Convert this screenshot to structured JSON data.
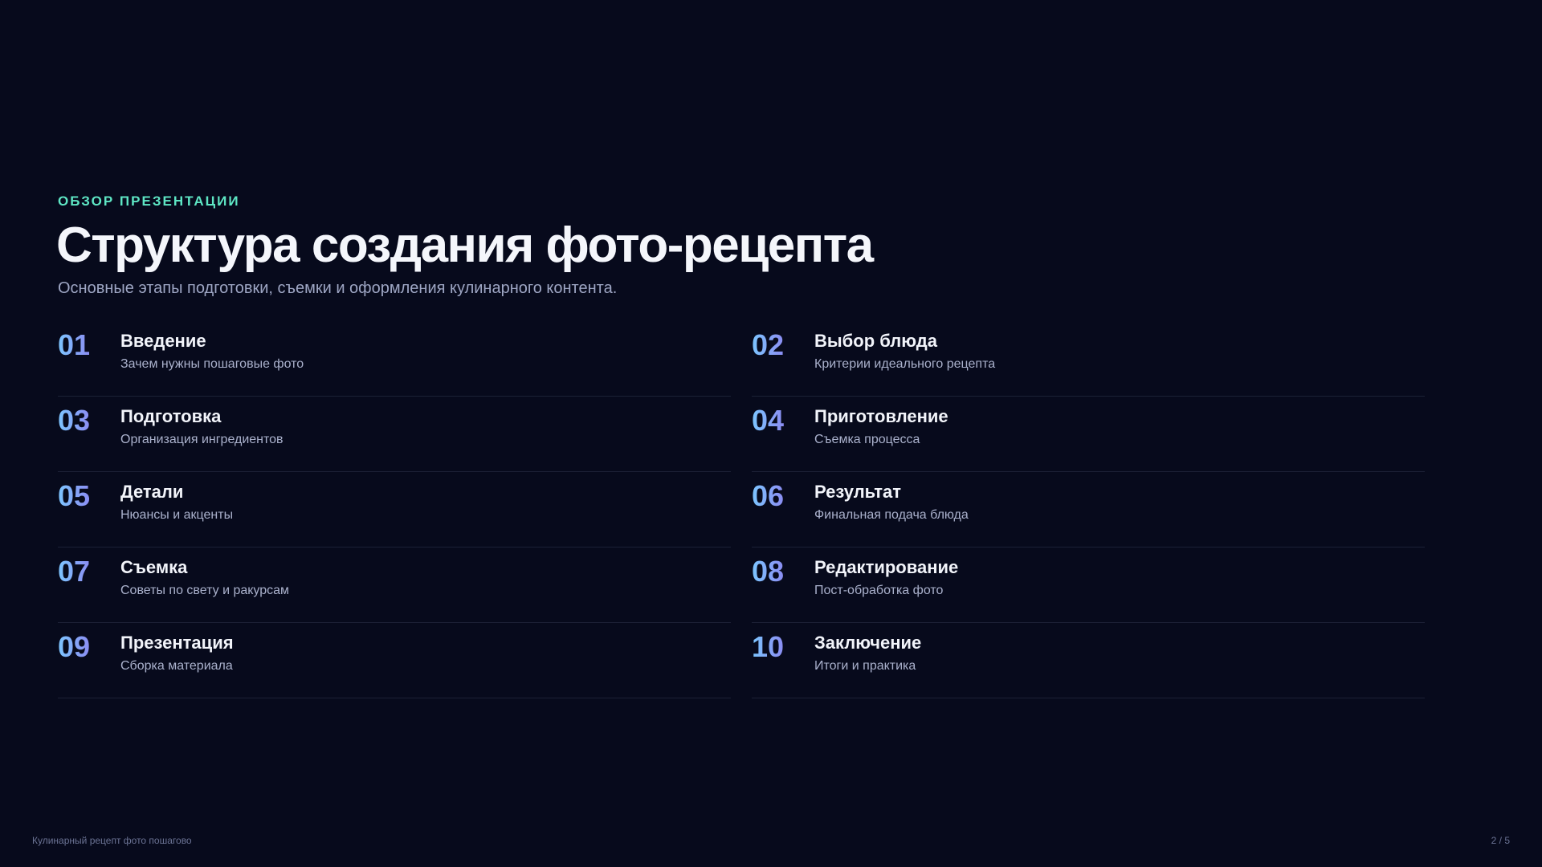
{
  "slide": {
    "eyebrow": "ОБЗОР ПРЕЗЕНТАЦИИ",
    "title": "Структура создания фото-рецепта",
    "subtitle": "Основные этапы подготовки, съемки и оформления кулинарного контента."
  },
  "items": [
    {
      "num": "01",
      "title": "Введение",
      "desc": "Зачем нужны пошаговые фото"
    },
    {
      "num": "02",
      "title": "Выбор блюда",
      "desc": "Критерии идеального рецепта"
    },
    {
      "num": "03",
      "title": "Подготовка",
      "desc": "Организация ингредиентов"
    },
    {
      "num": "04",
      "title": "Приготовление",
      "desc": "Съемка процесса"
    },
    {
      "num": "05",
      "title": "Детали",
      "desc": "Нюансы и акценты"
    },
    {
      "num": "06",
      "title": "Результат",
      "desc": "Финальная подача блюда"
    },
    {
      "num": "07",
      "title": "Съемка",
      "desc": "Советы по свету и ракурсам"
    },
    {
      "num": "08",
      "title": "Редактирование",
      "desc": "Пост-обработка фото"
    },
    {
      "num": "09",
      "title": "Презентация",
      "desc": "Сборка материала"
    },
    {
      "num": "10",
      "title": "Заключение",
      "desc": "Итоги и практика"
    }
  ],
  "footer": {
    "left": "Кулинарный рецепт фото пошагово",
    "page": "2 / 5"
  },
  "colors": {
    "background": "#070a1c",
    "accent_eyebrow": "#5ee6c4",
    "number_gradient_start": "#7cc6ff",
    "number_gradient_end": "#8b8cf2"
  }
}
